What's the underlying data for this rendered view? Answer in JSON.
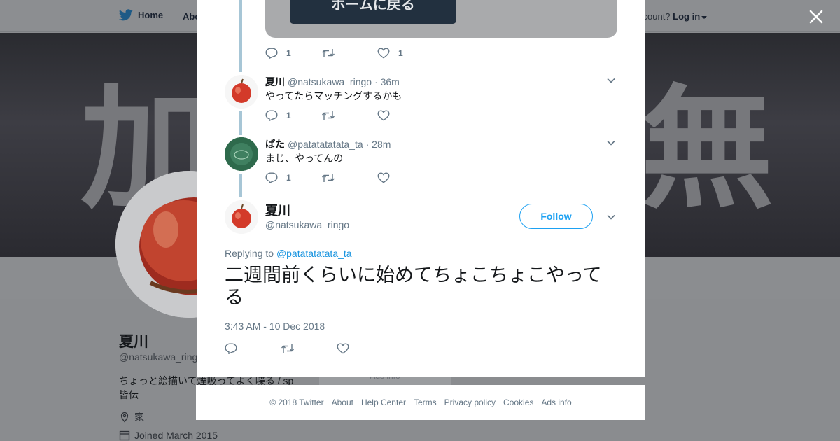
{
  "nav": {
    "home": "Home",
    "about": "Abo",
    "account_text": "ccount?",
    "login": "Log in"
  },
  "banner": {
    "left_char": "加",
    "right_char": "無"
  },
  "profile": {
    "name": "夏川",
    "handle": "@natsukawa_ringo",
    "bio": "ちょっと絵描いて煙吸ってよく喋る / sp 皆伝",
    "location": "家",
    "joined": "Joined March 2015",
    "ads_info": "Ads info"
  },
  "media": {
    "button_label": "ホームに戻る"
  },
  "thread": {
    "first_actions": {
      "reply": "1",
      "retweet": "",
      "like": "1"
    },
    "replies": [
      {
        "name": "夏川",
        "handle": "@natsukawa_ringo",
        "time": "· 36m",
        "text": "やってたらマッチングするかも",
        "actions": {
          "reply": "1",
          "retweet": "",
          "like": ""
        }
      },
      {
        "name": "ぱた",
        "handle": "@patatatatata_ta",
        "time": "· 28m",
        "text": "まじ、やってんの",
        "actions": {
          "reply": "1",
          "retweet": "",
          "like": ""
        }
      }
    ]
  },
  "main_tweet": {
    "name": "夏川",
    "handle": "@natsukawa_ringo",
    "follow_label": "Follow",
    "replying_prefix": "Replying to",
    "replying_to": "@patatatatata_ta",
    "text": "二週間前くらいに始めてちょこちょこやってる",
    "timestamp": "3:43 AM - 10 Dec 2018"
  },
  "footer": {
    "copyright": "© 2018 Twitter",
    "links": [
      "About",
      "Help Center",
      "Terms",
      "Privacy policy",
      "Cookies",
      "Ads info"
    ]
  },
  "colors": {
    "accent": "#1da1f2",
    "thread_line": "#a7c6d6",
    "meta_text": "#657786"
  },
  "icons": [
    "twitter-bird-icon",
    "close-icon",
    "reply-icon",
    "retweet-icon",
    "like-icon",
    "chevron-down-icon",
    "location-icon",
    "calendar-icon"
  ]
}
